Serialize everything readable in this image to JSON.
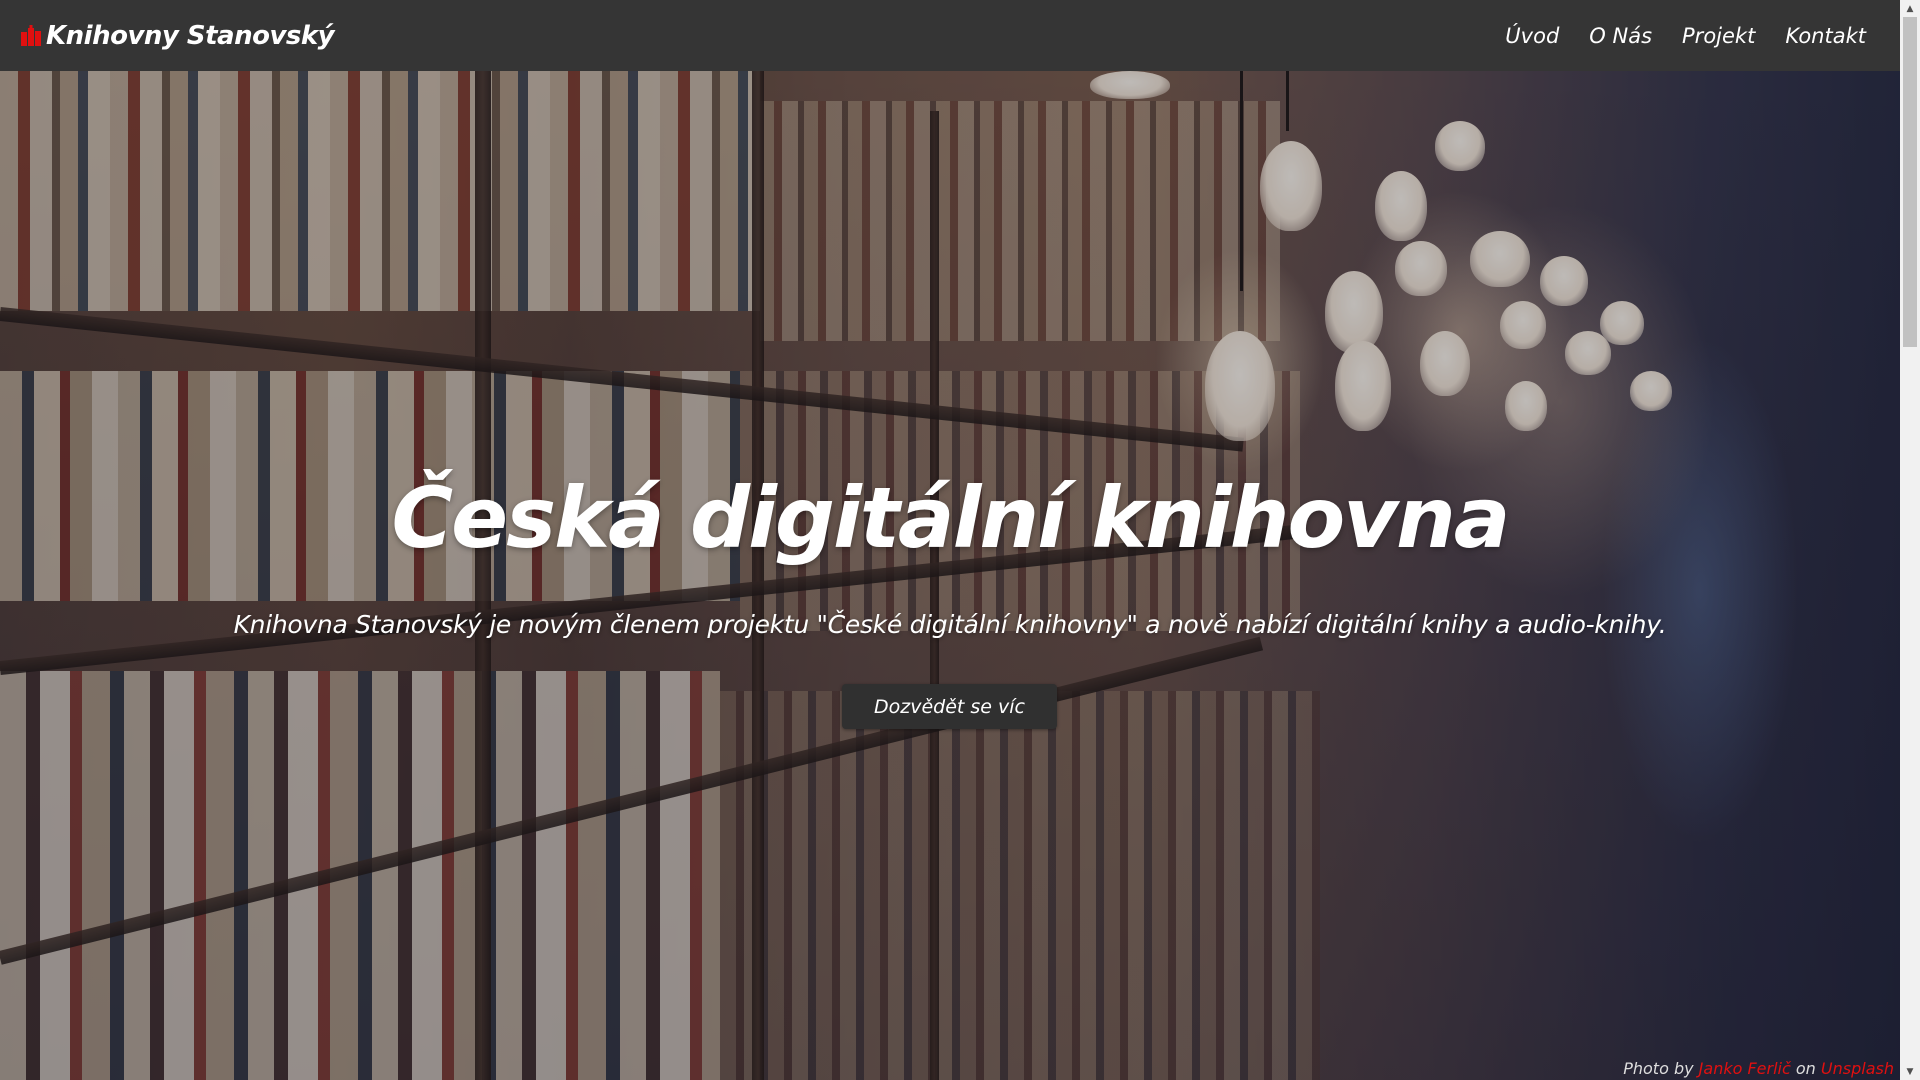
{
  "header": {
    "brand": "Knihovny Stanovský",
    "brand_icon": "books-icon",
    "accent_color": "#e01010",
    "nav": [
      {
        "label": "Úvod"
      },
      {
        "label": "O Nás"
      },
      {
        "label": "Projekt"
      },
      {
        "label": "Kontakt"
      }
    ]
  },
  "hero": {
    "title": "Česká digitální knihovna",
    "subtitle": "Knihovna Stanovský je novým členem projektu \"České digitální knihovny\" a nově nabízí digitální knihy a audio-knihy.",
    "button_label": "Dozvědět se víc"
  },
  "credit": {
    "prefix": "Photo by",
    "author": "Janko Ferlič",
    "middle": "on",
    "site": "Unsplash"
  },
  "scrollbar": {
    "up_icon": "scroll-up-arrow-icon",
    "down_icon": "scroll-down-arrow-icon"
  }
}
